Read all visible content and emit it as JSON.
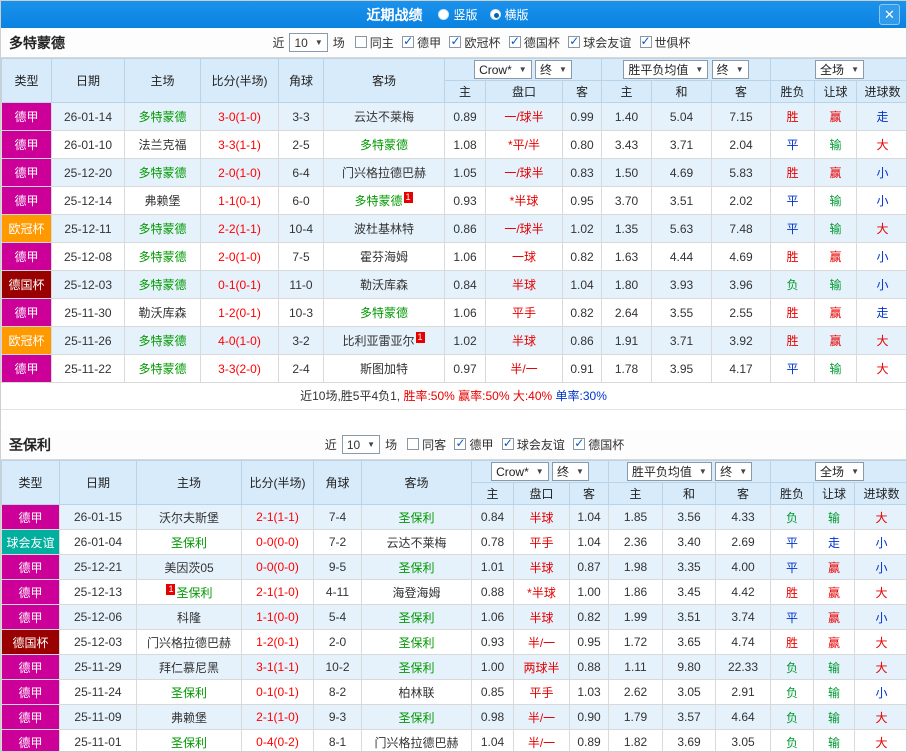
{
  "header": {
    "title": "近期战绩",
    "radio_vertical": "竖版",
    "radio_horizontal": "横版",
    "close_icon": "✕"
  },
  "columns": {
    "type": "类型",
    "date": "日期",
    "home": "主场",
    "score": "比分(半场)",
    "corner": "角球",
    "away": "客场",
    "odds_company": "Crow*",
    "odds_final": "终",
    "avg_select": "胜平负均值",
    "avg_final": "终",
    "scope_select": "全场",
    "sub_home": "主",
    "sub_handicap": "盘口",
    "sub_away": "客",
    "sub_avg_home": "主",
    "sub_avg_draw": "和",
    "sub_avg_away": "客",
    "sub_wdl": "胜负",
    "sub_handicap_result": "让球",
    "sub_goals": "进球数"
  },
  "sections": [
    {
      "team": "多特蒙德",
      "filter": {
        "near": "近",
        "count": "10",
        "games": "场",
        "checkboxes": [
          {
            "label": "同主",
            "state": ""
          },
          {
            "label": "德甲",
            "state": "checked"
          },
          {
            "label": "欧冠杯",
            "state": "checked"
          },
          {
            "label": "德国杯",
            "state": "checked"
          },
          {
            "label": "球会友谊",
            "state": "checked"
          },
          {
            "label": "世俱杯",
            "state": "checked"
          }
        ]
      },
      "rows": [
        {
          "type": "德甲",
          "type_class": "lg-jia",
          "date": "26-01-14",
          "home": "多特蒙德",
          "home_class": "hl",
          "score": "3-0(1-0)",
          "corner": "3-3",
          "away": "云达不莱梅",
          "odds_home": "0.89",
          "handicap": "一/球半",
          "odds_away": "0.99",
          "avg_home": "1.40",
          "avg_draw": "5.04",
          "avg_away": "7.15",
          "wdl": "胜",
          "wdl_class": "red",
          "hr": "赢",
          "hr_class": "red",
          "goals": "走",
          "goals_class": "blue"
        },
        {
          "type": "德甲",
          "type_class": "lg-jia",
          "date": "26-01-10",
          "home": "法兰克福",
          "score": "3-3(1-1)",
          "corner": "2-5",
          "away": "多特蒙德",
          "away_class": "hl",
          "odds_home": "1.08",
          "handicap": "*平/半",
          "odds_away": "0.80",
          "avg_home": "3.43",
          "avg_draw": "3.71",
          "avg_away": "2.04",
          "wdl": "平",
          "wdl_class": "blue",
          "hr": "输",
          "hr_class": "green",
          "goals": "大",
          "goals_class": "red"
        },
        {
          "type": "德甲",
          "type_class": "lg-jia",
          "date": "25-12-20",
          "home": "多特蒙德",
          "home_class": "hl",
          "score": "2-0(1-0)",
          "corner": "6-4",
          "away": "门兴格拉德巴赫",
          "odds_home": "1.05",
          "handicap": "一/球半",
          "odds_away": "0.83",
          "avg_home": "1.50",
          "avg_draw": "4.69",
          "avg_away": "5.83",
          "wdl": "胜",
          "wdl_class": "red",
          "hr": "赢",
          "hr_class": "red",
          "goals": "小",
          "goals_class": "blue"
        },
        {
          "type": "德甲",
          "type_class": "lg-jia",
          "date": "25-12-14",
          "home": "弗赖堡",
          "score": "1-1(0-1)",
          "corner": "6-0",
          "away": "多特蒙德",
          "away_class": "hl",
          "away_badge_post": "1",
          "odds_home": "0.93",
          "handicap": "*半球",
          "odds_away": "0.95",
          "avg_home": "3.70",
          "avg_draw": "3.51",
          "avg_away": "2.02",
          "wdl": "平",
          "wdl_class": "blue",
          "hr": "输",
          "hr_class": "green",
          "goals": "小",
          "goals_class": "blue"
        },
        {
          "type": "欧冠杯",
          "type_class": "lg-ouguan",
          "date": "25-12-11",
          "home": "多特蒙德",
          "home_class": "hl",
          "score": "2-2(1-1)",
          "corner": "10-4",
          "away": "波杜基林特",
          "odds_home": "0.86",
          "handicap": "一/球半",
          "odds_away": "1.02",
          "avg_home": "1.35",
          "avg_draw": "5.63",
          "avg_away": "7.48",
          "wdl": "平",
          "wdl_class": "blue",
          "hr": "输",
          "hr_class": "green",
          "goals": "大",
          "goals_class": "red"
        },
        {
          "type": "德甲",
          "type_class": "lg-jia",
          "date": "25-12-08",
          "home": "多特蒙德",
          "home_class": "hl",
          "score": "2-0(1-0)",
          "corner": "7-5",
          "away": "霍芬海姆",
          "odds_home": "1.06",
          "handicap": "一球",
          "odds_away": "0.82",
          "avg_home": "1.63",
          "avg_draw": "4.44",
          "avg_away": "4.69",
          "wdl": "胜",
          "wdl_class": "red",
          "hr": "赢",
          "hr_class": "red",
          "goals": "小",
          "goals_class": "blue"
        },
        {
          "type": "德国杯",
          "type_class": "lg-deguobei",
          "date": "25-12-03",
          "home": "多特蒙德",
          "home_class": "hl",
          "score": "0-1(0-1)",
          "corner": "11-0",
          "away": "勒沃库森",
          "odds_home": "0.84",
          "handicap": "半球",
          "odds_away": "1.04",
          "avg_home": "1.80",
          "avg_draw": "3.93",
          "avg_away": "3.96",
          "wdl": "负",
          "wdl_class": "green",
          "hr": "输",
          "hr_class": "green",
          "goals": "小",
          "goals_class": "blue"
        },
        {
          "type": "德甲",
          "type_class": "lg-jia",
          "date": "25-11-30",
          "home": "勒沃库森",
          "score": "1-2(0-1)",
          "corner": "10-3",
          "away": "多特蒙德",
          "away_class": "hl",
          "odds_home": "1.06",
          "handicap": "平手",
          "odds_away": "0.82",
          "avg_home": "2.64",
          "avg_draw": "3.55",
          "avg_away": "2.55",
          "wdl": "胜",
          "wdl_class": "red",
          "hr": "赢",
          "hr_class": "red",
          "goals": "走",
          "goals_class": "blue"
        },
        {
          "type": "欧冠杯",
          "type_class": "lg-ouguan",
          "date": "25-11-26",
          "home": "多特蒙德",
          "home_class": "hl",
          "score": "4-0(1-0)",
          "corner": "3-2",
          "away": "比利亚雷亚尔",
          "away_badge_post": "1",
          "odds_home": "1.02",
          "handicap": "半球",
          "odds_away": "0.86",
          "avg_home": "1.91",
          "avg_draw": "3.71",
          "avg_away": "3.92",
          "wdl": "胜",
          "wdl_class": "red",
          "hr": "赢",
          "hr_class": "red",
          "goals": "大",
          "goals_class": "red"
        },
        {
          "type": "德甲",
          "type_class": "lg-jia",
          "date": "25-11-22",
          "home": "多特蒙德",
          "home_class": "hl",
          "score": "3-3(2-0)",
          "corner": "2-4",
          "away": "斯图加特",
          "odds_home": "0.97",
          "handicap": "半/一",
          "odds_away": "0.91",
          "avg_home": "1.78",
          "avg_draw": "3.95",
          "avg_away": "4.17",
          "wdl": "平",
          "wdl_class": "blue",
          "hr": "输",
          "hr_class": "green",
          "goals": "大",
          "goals_class": "red"
        }
      ],
      "summary": [
        {
          "text": "近10场,胜5平4负1,",
          "color": "#333333"
        },
        {
          "text": " 胜率:50%",
          "color": "#e80000"
        },
        {
          "text": " 赢率:50%",
          "color": "#e80000"
        },
        {
          "text": " 大:40%",
          "color": "#e80000"
        },
        {
          "text": " 单率:30%",
          "color": "#0033cc"
        }
      ]
    },
    {
      "team": "圣保利",
      "filter": {
        "near": "近",
        "count": "10",
        "games": "场",
        "checkboxes": [
          {
            "label": "同客",
            "state": ""
          },
          {
            "label": "德甲",
            "state": "checked"
          },
          {
            "label": "球会友谊",
            "state": "checked"
          },
          {
            "label": "德国杯",
            "state": "checked"
          }
        ]
      },
      "rows": [
        {
          "type": "德甲",
          "type_class": "lg-jia",
          "date": "26-01-15",
          "home": "沃尔夫斯堡",
          "score": "2-1(1-1)",
          "corner": "7-4",
          "away": "圣保利",
          "away_class": "hl",
          "odds_home": "0.84",
          "handicap": "半球",
          "odds_away": "1.04",
          "avg_home": "1.85",
          "avg_draw": "3.56",
          "avg_away": "4.33",
          "wdl": "负",
          "wdl_class": "green",
          "hr": "输",
          "hr_class": "green",
          "goals": "大",
          "goals_class": "red"
        },
        {
          "type": "球会友谊",
          "type_class": "lg-youyi",
          "date": "26-01-04",
          "home": "圣保利",
          "home_class": "hl",
          "score": "0-0(0-0)",
          "corner": "7-2",
          "away": "云达不莱梅",
          "odds_home": "0.78",
          "handicap": "平手",
          "odds_away": "1.04",
          "avg_home": "2.36",
          "avg_draw": "3.40",
          "avg_away": "2.69",
          "wdl": "平",
          "wdl_class": "blue",
          "hr": "走",
          "hr_class": "blue",
          "goals": "小",
          "goals_class": "blue"
        },
        {
          "type": "德甲",
          "type_class": "lg-jia",
          "date": "25-12-21",
          "home": "美因茨05",
          "score": "0-0(0-0)",
          "corner": "9-5",
          "away": "圣保利",
          "away_class": "hl",
          "odds_home": "1.01",
          "handicap": "半球",
          "odds_away": "0.87",
          "avg_home": "1.98",
          "avg_draw": "3.35",
          "avg_away": "4.00",
          "wdl": "平",
          "wdl_class": "blue",
          "hr": "赢",
          "hr_class": "red",
          "goals": "小",
          "goals_class": "blue"
        },
        {
          "type": "德甲",
          "type_class": "lg-jia",
          "date": "25-12-13",
          "home": "圣保利",
          "home_class": "hl",
          "home_badge_pre": "1",
          "score": "2-1(1-0)",
          "corner": "4-11",
          "away": "海登海姆",
          "odds_home": "0.88",
          "handicap": "*半球",
          "odds_away": "1.00",
          "avg_home": "1.86",
          "avg_draw": "3.45",
          "avg_away": "4.42",
          "wdl": "胜",
          "wdl_class": "red",
          "hr": "赢",
          "hr_class": "red",
          "goals": "大",
          "goals_class": "red"
        },
        {
          "type": "德甲",
          "type_class": "lg-jia",
          "date": "25-12-06",
          "home": "科隆",
          "score": "1-1(0-0)",
          "corner": "5-4",
          "away": "圣保利",
          "away_class": "hl",
          "odds_home": "1.06",
          "handicap": "半球",
          "odds_away": "0.82",
          "avg_home": "1.99",
          "avg_draw": "3.51",
          "avg_away": "3.74",
          "wdl": "平",
          "wdl_class": "blue",
          "hr": "赢",
          "hr_class": "red",
          "goals": "小",
          "goals_class": "blue"
        },
        {
          "type": "德国杯",
          "type_class": "lg-deguobei",
          "date": "25-12-03",
          "home": "门兴格拉德巴赫",
          "score": "1-2(0-1)",
          "corner": "2-0",
          "away": "圣保利",
          "away_class": "hl",
          "odds_home": "0.93",
          "handicap": "半/一",
          "odds_away": "0.95",
          "avg_home": "1.72",
          "avg_draw": "3.65",
          "avg_away": "4.74",
          "wdl": "胜",
          "wdl_class": "red",
          "hr": "赢",
          "hr_class": "red",
          "goals": "大",
          "goals_class": "red"
        },
        {
          "type": "德甲",
          "type_class": "lg-jia",
          "date": "25-11-29",
          "home": "拜仁慕尼黑",
          "score": "3-1(1-1)",
          "corner": "10-2",
          "away": "圣保利",
          "away_class": "hl",
          "odds_home": "1.00",
          "handicap": "两球半",
          "odds_away": "0.88",
          "avg_home": "1.11",
          "avg_draw": "9.80",
          "avg_away": "22.33",
          "wdl": "负",
          "wdl_class": "green",
          "hr": "输",
          "hr_class": "green",
          "goals": "大",
          "goals_class": "red"
        },
        {
          "type": "德甲",
          "type_class": "lg-jia",
          "date": "25-11-24",
          "home": "圣保利",
          "home_class": "hl",
          "score": "0-1(0-1)",
          "corner": "8-2",
          "away": "柏林联",
          "odds_home": "0.85",
          "handicap": "平手",
          "odds_away": "1.03",
          "avg_home": "2.62",
          "avg_draw": "3.05",
          "avg_away": "2.91",
          "wdl": "负",
          "wdl_class": "green",
          "hr": "输",
          "hr_class": "green",
          "goals": "小",
          "goals_class": "blue"
        },
        {
          "type": "德甲",
          "type_class": "lg-jia",
          "date": "25-11-09",
          "home": "弗赖堡",
          "score": "2-1(1-0)",
          "corner": "9-3",
          "away": "圣保利",
          "away_class": "hl",
          "odds_home": "0.98",
          "handicap": "半/一",
          "odds_away": "0.90",
          "avg_home": "1.79",
          "avg_draw": "3.57",
          "avg_away": "4.64",
          "wdl": "负",
          "wdl_class": "green",
          "hr": "输",
          "hr_class": "green",
          "goals": "大",
          "goals_class": "red"
        },
        {
          "type": "德甲",
          "type_class": "lg-jia",
          "date": "25-11-01",
          "home": "圣保利",
          "home_class": "hl",
          "score": "0-4(0-2)",
          "corner": "8-1",
          "away": "门兴格拉德巴赫",
          "odds_home": "1.04",
          "handicap": "半/一",
          "odds_away": "0.89",
          "avg_home": "1.82",
          "avg_draw": "3.69",
          "avg_away": "3.05",
          "wdl": "负",
          "wdl_class": "green",
          "hr": "输",
          "hr_class": "green",
          "goals": "大",
          "goals_class": "red"
        }
      ],
      "summary": []
    }
  ]
}
